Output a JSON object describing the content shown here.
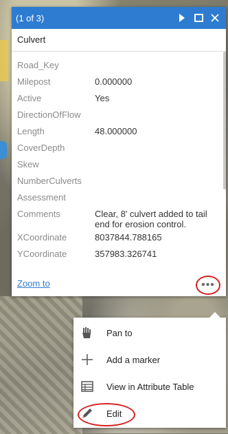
{
  "popup": {
    "count": "(1 of 3)",
    "title": "Culvert",
    "fields": [
      {
        "name": "Road_Key",
        "value": ""
      },
      {
        "name": "Milepost",
        "value": "0.000000"
      },
      {
        "name": "Active",
        "value": "Yes"
      },
      {
        "name": "DirectionOfFlow",
        "value": ""
      },
      {
        "name": "Length",
        "value": "48.000000"
      },
      {
        "name": "CoverDepth",
        "value": ""
      },
      {
        "name": "Skew",
        "value": ""
      },
      {
        "name": "NumberCulverts",
        "value": ""
      },
      {
        "name": "Assessment",
        "value": ""
      },
      {
        "name": "Comments",
        "value": "Clear, 8' culvert added to tail end for erosion control."
      },
      {
        "name": "XCoordinate",
        "value": "8037844.788165"
      },
      {
        "name": "YCoordinate",
        "value": "357983.326741"
      }
    ],
    "zoom_label": "Zoom to",
    "more_label": "•••"
  },
  "menu": {
    "items": [
      {
        "label": "Pan to",
        "icon": "pan-icon"
      },
      {
        "label": "Add a marker",
        "icon": "plus-icon"
      },
      {
        "label": "View in Attribute Table",
        "icon": "table-icon"
      },
      {
        "label": "Edit",
        "icon": "pencil-icon"
      }
    ]
  },
  "colors": {
    "header": "#2e7cd1",
    "link": "#2e7cd1",
    "highlight": "#d61f1f"
  }
}
